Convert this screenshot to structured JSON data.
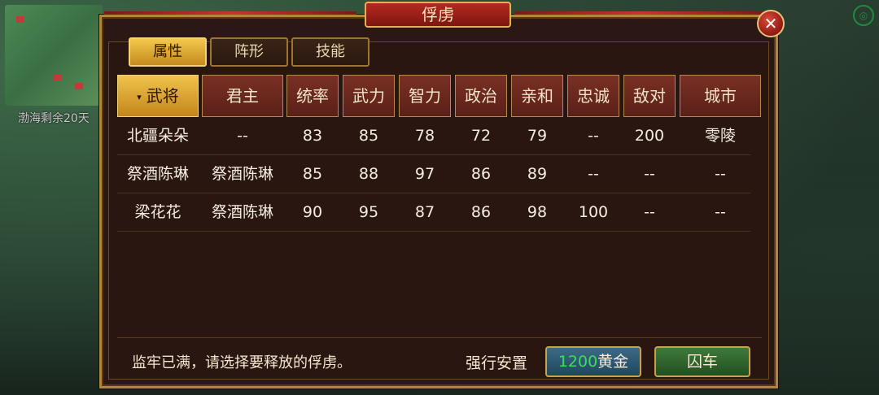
{
  "background": {
    "minimap_text": "渤海剩余20天"
  },
  "dialog": {
    "title": "俘虏",
    "close_symbol": "✕"
  },
  "tabs": [
    {
      "label": "属性",
      "active": true
    },
    {
      "label": "阵形",
      "active": false
    },
    {
      "label": "技能",
      "active": false
    }
  ],
  "table": {
    "sort_indicator": "▾",
    "headers": [
      "武将",
      "君主",
      "统率",
      "武力",
      "智力",
      "政治",
      "亲和",
      "忠诚",
      "敌对",
      "城市"
    ],
    "rows": [
      [
        "北疆朵朵",
        "--",
        "83",
        "85",
        "78",
        "72",
        "79",
        "--",
        "200",
        "零陵"
      ],
      [
        "祭酒陈琳",
        "祭酒陈琳",
        "85",
        "88",
        "97",
        "86",
        "89",
        "--",
        "--",
        "--"
      ],
      [
        "梁花花",
        "祭酒陈琳",
        "90",
        "95",
        "87",
        "86",
        "98",
        "100",
        "--",
        "--"
      ]
    ]
  },
  "footer": {
    "message": "监牢已满，请选择要释放的俘虏。",
    "force_label": "强行安置",
    "gold_amount": "1200",
    "gold_unit": "黄金",
    "cage_button": "囚车"
  },
  "colors": {
    "panel_bg": "#2b1713",
    "frame_gold": "#b0863e",
    "active_tab": "#f0c44a",
    "header_red": "#7a3024",
    "gold_amount": "#38e05a"
  }
}
